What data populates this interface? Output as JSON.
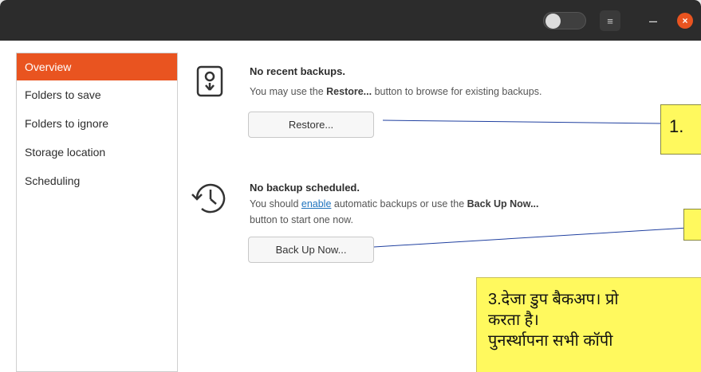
{
  "window": {
    "controls": {
      "menu_icon": "≡",
      "minimize_icon": "–",
      "close_icon": "×"
    }
  },
  "sidebar": {
    "items": [
      {
        "label": "Overview",
        "active": true
      },
      {
        "label": "Folders to save",
        "active": false
      },
      {
        "label": "Folders to ignore",
        "active": false
      },
      {
        "label": "Storage location",
        "active": false
      },
      {
        "label": "Scheduling",
        "active": false
      }
    ]
  },
  "main": {
    "restore": {
      "title": "No recent backups.",
      "desc_prefix": "You may use the ",
      "desc_bold": "Restore...",
      "desc_suffix": " button to browse for existing backups.",
      "button_label": "Restore..."
    },
    "schedule": {
      "title": "No backup scheduled.",
      "desc_prefix": "You should ",
      "desc_link": "enable",
      "desc_middle": " automatic backups or use the ",
      "desc_bold": "Back Up Now...",
      "desc_line2": "button to start one now.",
      "button_label": "Back Up Now..."
    }
  },
  "annotations": {
    "callout_1": "1.",
    "callout_3_line1": "3.देजा डुप बैकअप। प्रो",
    "callout_3_line2": "करता है।",
    "callout_3_line3": "पुनर्स्थापना सभी कॉपी"
  },
  "colors": {
    "accent": "#e95420",
    "titlebar": "#2c2c2c",
    "callout": "#fff95e",
    "link": "#1e73be"
  }
}
